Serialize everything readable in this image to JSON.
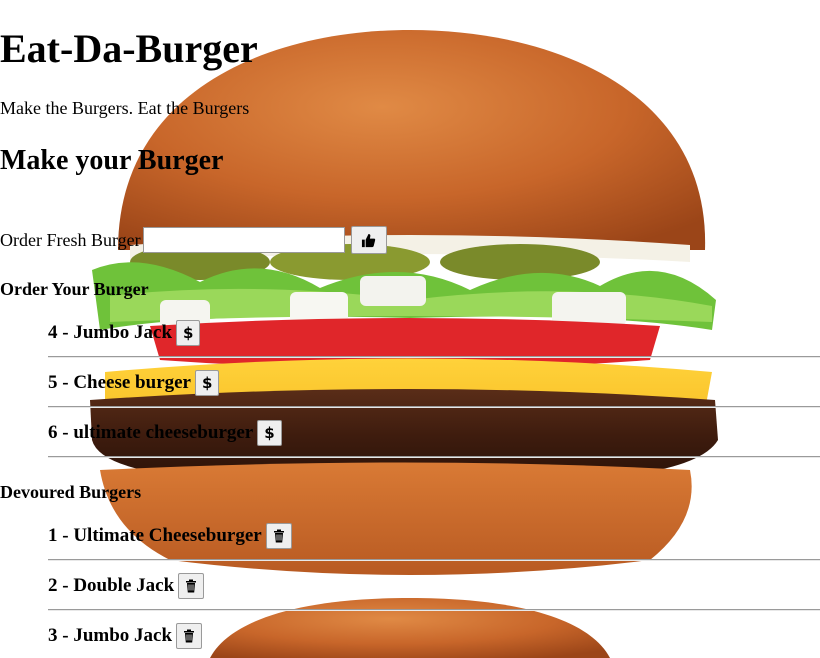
{
  "app": {
    "title": "Eat-Da-Burger",
    "tagline": "Make the Burgers. Eat the Burgers"
  },
  "make_section": {
    "heading": "Make your Burger",
    "input_label": "Order Fresh Burger",
    "input_value": "",
    "input_placeholder": "",
    "submit_icon": "thumbs-up-icon"
  },
  "order_section": {
    "heading": "Order Your Burger",
    "action_icon": "dollar-icon",
    "action_label": "$",
    "items": [
      {
        "label": "4 - Jumbo Jack"
      },
      {
        "label": "5 - Cheese burger"
      },
      {
        "label": "6 - ultimate cheeseburger"
      }
    ]
  },
  "devoured_section": {
    "heading": "Devoured Burgers",
    "action_icon": "trash-icon",
    "items": [
      {
        "label": "1 - Ultimate Cheeseburger"
      },
      {
        "label": "2 - Double Jack"
      },
      {
        "label": "3 - Jumbo Jack"
      }
    ]
  },
  "background_image": "burger-photo"
}
